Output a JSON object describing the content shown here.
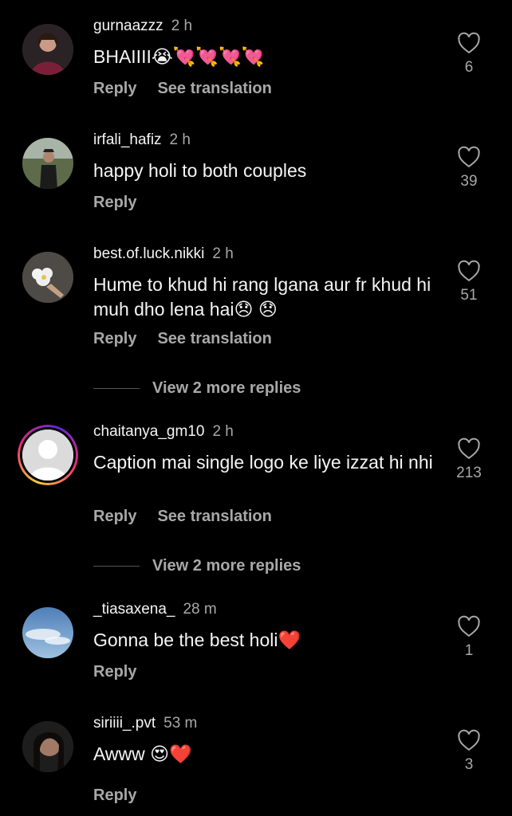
{
  "comments": [
    {
      "username": "gurnaazzz",
      "time": "2 h",
      "text": "BHAIIII😭💘💘💘💘",
      "likes": "6",
      "reply": "Reply",
      "translate": "See translation"
    },
    {
      "username": "irfali_hafiz",
      "time": "2 h",
      "text": "happy holi to both couples",
      "likes": "39",
      "reply": "Reply"
    },
    {
      "username": "best.of.luck.nikki",
      "time": "2 h",
      "text": "Hume to khud hi rang lgana aur fr khud hi muh dho lena hai😞 😞",
      "likes": "51",
      "reply": "Reply",
      "translate": "See translation",
      "more_replies": "View 2 more replies"
    },
    {
      "username": "chaitanya_gm10",
      "time": "2 h",
      "text": "Caption mai single logo ke liye izzat hi nhi",
      "likes": "213",
      "reply": "Reply",
      "translate": "See translation",
      "more_replies": "View 2 more replies"
    },
    {
      "username": "_tiasaxena_",
      "time": "28 m",
      "text": "Gonna be the best holi❤️",
      "likes": "1",
      "reply": "Reply"
    },
    {
      "username": "siriiii_.pvt",
      "time": "53 m",
      "text": "Awww 😍❤️",
      "likes": "3",
      "reply": "Reply"
    }
  ],
  "icons": {
    "like": "heart-outline-icon"
  },
  "colors": {
    "background": "#000000",
    "muted": "#a8a8a8",
    "text": "#f5f5f5"
  }
}
